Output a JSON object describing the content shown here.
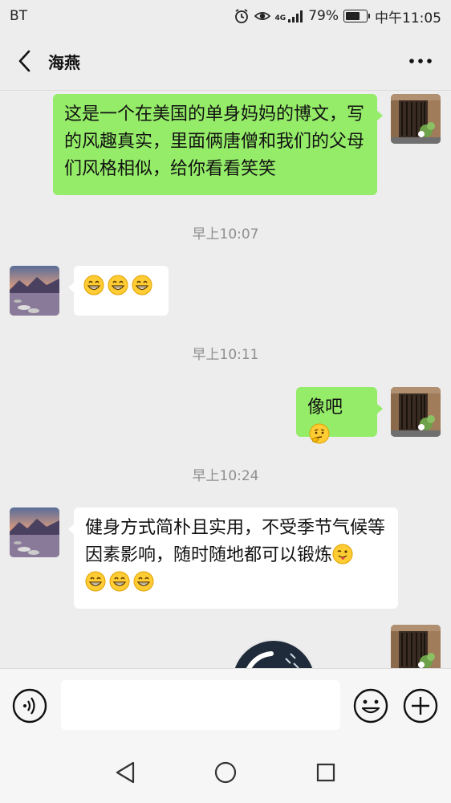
{
  "status_bar": {
    "carrier": "BT",
    "network": "4G",
    "battery": "79%",
    "battery_level": 0.79,
    "time": "中午11:05"
  },
  "header": {
    "title": "海燕"
  },
  "messages": [
    {
      "type": "outgoing",
      "text": "这是一个在美国的单身妈妈的博文，写的风趣真实，里面俩唐僧和我们的父母们风格相似，给你看看笑笑"
    },
    {
      "type": "timestamp",
      "text": "早上10:07"
    },
    {
      "type": "incoming",
      "emojis": [
        "grinning-emoji",
        "grinning-emoji",
        "grinning-emoji"
      ]
    },
    {
      "type": "timestamp",
      "text": "早上10:11"
    },
    {
      "type": "outgoing",
      "text": "像吧",
      "emoji": "thinking-emoji"
    },
    {
      "type": "timestamp",
      "text": "早上10:24"
    },
    {
      "type": "incoming",
      "text": "健身方式简朴且实用，不受季节气候等因素影响，随时随地都可以锻炼",
      "emoji": "winking-tongue-emoji",
      "trailing_emojis": [
        "grinning-emoji",
        "grinning-emoji",
        "grinning-emoji"
      ]
    },
    {
      "type": "outgoing-image",
      "description": "photo-message"
    }
  ],
  "input_bar": {
    "voice_icon": "voice-icon",
    "emoji_icon": "emoji-icon",
    "plus_icon": "plus-icon",
    "placeholder": ""
  },
  "nav_bar": {
    "icons": [
      "back-triangle-icon",
      "home-circle-icon",
      "recents-square-icon"
    ]
  },
  "colors": {
    "outgoing_bubble": "#95ec69",
    "incoming_bubble": "#ffffff",
    "background": "#ededed"
  }
}
